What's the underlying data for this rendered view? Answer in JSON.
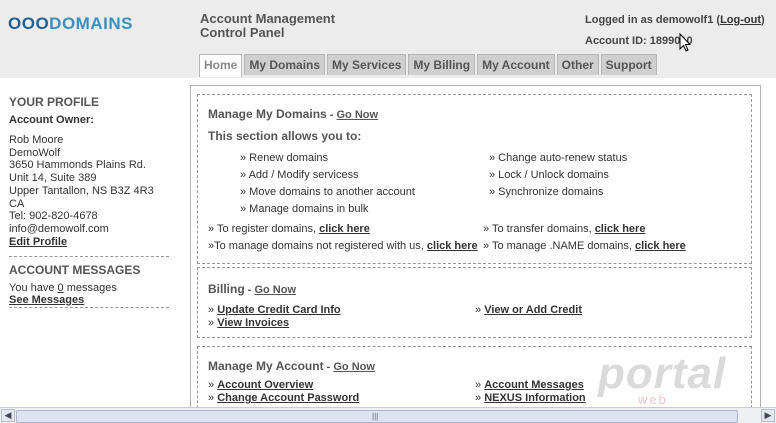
{
  "header": {
    "logo": {
      "part1": "OOO",
      "part2": "DOMAINS"
    },
    "title_line1": "Account Management",
    "title_line2": "Control Panel",
    "logged_in_prefix": "Logged in as demowolf1 (",
    "logout_label": "Log-out",
    "logged_in_suffix": ")",
    "account_id": "Account ID: 1899010"
  },
  "tabs": [
    {
      "label": "Home",
      "active": true
    },
    {
      "label": "My Domains"
    },
    {
      "label": "My Services"
    },
    {
      "label": "My Billing"
    },
    {
      "label": "My Account"
    },
    {
      "label": "Other"
    },
    {
      "label": "Support"
    }
  ],
  "sidebar": {
    "profile_heading": "YOUR PROFILE",
    "owner_heading": "Account Owner:",
    "address": [
      "Rob Moore",
      "DemoWolf",
      "3650 Hammonds Plains Rd.",
      "Unit 14, Suite 389",
      "Upper Tantallon, NS B3Z 4R3",
      "CA",
      "Tel: 902-820-4678",
      "info@demowolf.com"
    ],
    "edit_profile": "Edit Profile",
    "messages_heading": "ACCOUNT MESSAGES",
    "messages_pre": "You have ",
    "messages_count": "0",
    "messages_post": " messages",
    "see_messages": "See Messages"
  },
  "domains": {
    "heading": "Manage My Domains",
    "dash": " - ",
    "go_now": "Go Now",
    "intro": "This section allows you to:",
    "left_items": [
      "» Renew domains",
      "» Add / Modify servicess",
      "» Move domains to another account",
      "» Manage domains in bulk"
    ],
    "right_items": [
      "» Change auto-renew status",
      "» Lock / Unlock domains",
      "» Synchronize domains"
    ],
    "register_pre": "» To register domains, ",
    "transfer_pre": "» To transfer domains, ",
    "notreg_pre": "»To manage domains not registered with us, ",
    "name_pre": "» To manage .NAME domains, ",
    "click_here": "click here"
  },
  "billing": {
    "heading": "Billing",
    "dash": " - ",
    "go_now": "Go Now",
    "arrow": "» ",
    "update_cc": "Update Credit Card Info",
    "view_credit": "View or Add Credit",
    "view_invoices": "View Invoices"
  },
  "account": {
    "heading": "Manage My Account",
    "dash": " - ",
    "go_now": "Go Now",
    "arrow": "» ",
    "overview": "Account Overview",
    "change_pw": "Change Account Password",
    "messages": "Account Messages",
    "nexus": "NEXUS Information"
  },
  "watermark": {
    "line1": "portal",
    "line2": "web hosting"
  },
  "scrollbar": {
    "left_arrow": "◀",
    "right_arrow": "▶",
    "grip": "|||"
  },
  "colors": {
    "header_bg": "#ececec",
    "logo_blue": "#3a8fbf",
    "tab_bg": "#cfcfcf"
  }
}
